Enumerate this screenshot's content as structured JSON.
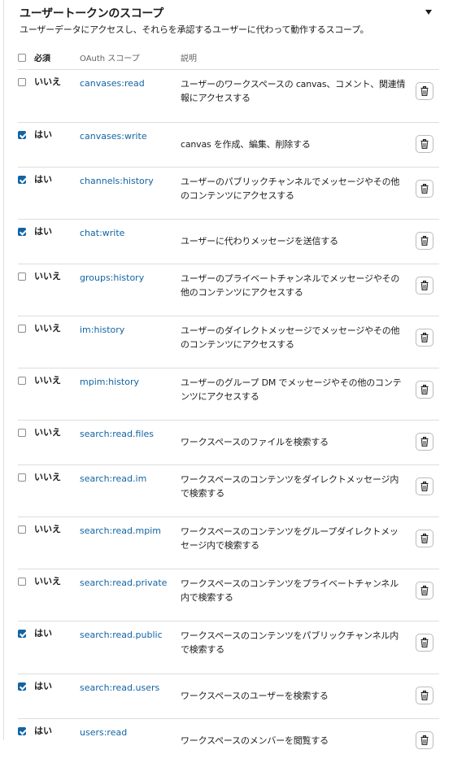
{
  "section": {
    "title": "ユーザートークンのスコープ",
    "subtitle": "ユーザーデータにアクセスし、それらを承認するユーザーに代わって動作するスコープ。",
    "collapse_icon": "caret-down-icon"
  },
  "table": {
    "headers": {
      "required": "必須",
      "scope": "OAuth スコープ",
      "description": "説明"
    },
    "rows": [
      {
        "checked": false,
        "required": "いいえ",
        "scope": "canvases:read",
        "description": "ユーザーのワークスペースの canvas、コメント、関連情報にアクセスする"
      },
      {
        "checked": true,
        "required": "はい",
        "scope": "canvases:write",
        "description": "canvas を作成、編集、削除する"
      },
      {
        "checked": true,
        "required": "はい",
        "scope": "channels:history",
        "description": "ユーザーのパブリックチャンネルでメッセージやその他のコンテンツにアクセスする"
      },
      {
        "checked": true,
        "required": "はい",
        "scope": "chat:write",
        "description": "ユーザーに代わりメッセージを送信する"
      },
      {
        "checked": false,
        "required": "いいえ",
        "scope": "groups:history",
        "description": "ユーザーのプライベートチャンネルでメッセージやその他のコンテンツにアクセスする"
      },
      {
        "checked": false,
        "required": "いいえ",
        "scope": "im:history",
        "description": "ユーザーのダイレクトメッセージでメッセージやその他のコンテンツにアクセスする"
      },
      {
        "checked": false,
        "required": "いいえ",
        "scope": "mpim:history",
        "description": "ユーザーのグループ DM でメッセージやその他のコンテンツにアクセスする"
      },
      {
        "checked": false,
        "required": "いいえ",
        "scope": "search:read.files",
        "description": "ワークスペースのファイルを検索する"
      },
      {
        "checked": false,
        "required": "いいえ",
        "scope": "search:read.im",
        "description": "ワークスペースのコンテンツをダイレクトメッセージ内で検索する"
      },
      {
        "checked": false,
        "required": "いいえ",
        "scope": "search:read.mpim",
        "description": "ワークスペースのコンテンツをグループダイレクトメッセージ内で検索する"
      },
      {
        "checked": false,
        "required": "いいえ",
        "scope": "search:read.private",
        "description": "ワークスペースのコンテンツをプライベートチャンネル内で検索する"
      },
      {
        "checked": true,
        "required": "はい",
        "scope": "search:read.public",
        "description": "ワークスペースのコンテンツをパブリックチャンネル内で検索する"
      },
      {
        "checked": true,
        "required": "はい",
        "scope": "search:read.users",
        "description": "ワークスペースのユーザーを検索する"
      },
      {
        "checked": true,
        "required": "はい",
        "scope": "users:read",
        "description": "ワークスペースのメンバーを閲覧する"
      }
    ],
    "row_action_icon": "trash-icon"
  },
  "colors": {
    "link": "#1264a3",
    "checkbox_checked": "#1264a3",
    "divider": "#dddddd"
  }
}
